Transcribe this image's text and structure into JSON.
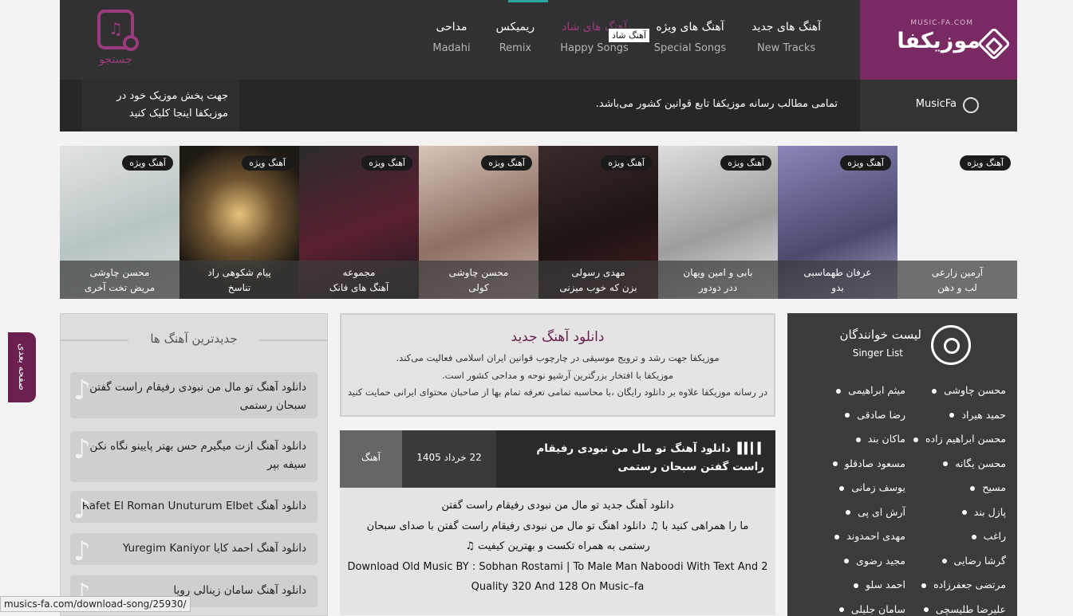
{
  "site": {
    "logo_text": "موزیکفا",
    "logo_site": "MUSIC-FA.COM"
  },
  "nav": [
    {
      "fa": "آهنگ های جدید",
      "en": "New Tracks"
    },
    {
      "fa": "آهنگ های ویژه",
      "en": "Special Songs"
    },
    {
      "fa": "آهنگ های شاد",
      "en": "Happy Songs"
    },
    {
      "fa": "ریمیکس",
      "en": "Remix"
    },
    {
      "fa": "مداحی",
      "en": "Madahi"
    }
  ],
  "tooltip": "آهنگ شاد",
  "search_label": "جستجو",
  "notice": {
    "brand": "MusicFa",
    "text": "تمامی مطالب رسانه موزیکفا تابع قوانین کشور می‌باشد.",
    "promo": "جهت پخش موزیک خود در موزیکفا اینجا کلیک کنید"
  },
  "slides": [
    {
      "badge": "آهنگ ویژه",
      "artist": "آرمین زارعی",
      "song": "لب و دهن",
      "bg": "linear-gradient(135deg,#b9bfc9,#7a808c 60,#d4d6dc)"
    },
    {
      "badge": "آهنگ ویژه",
      "artist": "عرفان طهماسبی",
      "song": "بدو",
      "bg": "linear-gradient(160deg,#8a86b8,#4b4a6e 60%,#a8a2c8)"
    },
    {
      "badge": "آهنگ ویژه",
      "artist": "بابی و امین ویهان",
      "song": "ددر دودور",
      "bg": "linear-gradient(160deg,#dedede,#9d9d9d 55%,#e9e9e9)"
    },
    {
      "badge": "آهنگ ویژه",
      "artist": "مهدی رسولی",
      "song": "بزن که خوب میزنی",
      "bg": "linear-gradient(160deg,#3a2b2b,#1e1414 55%,#4a1e1e)"
    },
    {
      "badge": "آهنگ ویژه",
      "artist": "محسن چاوشی",
      "song": "کولی",
      "bg": "linear-gradient(160deg,#d7c4b8,#8d6f63 55%,#c9b1a5)"
    },
    {
      "badge": "آهنگ ویژه",
      "artist": "مجموعه",
      "song": "آهنگ های فانک",
      "bg": "linear-gradient(160deg,#2b2b2b,#5a2030 55%,#1a1a1a)"
    },
    {
      "badge": "آهنگ ویژه",
      "artist": "پیام شکوهی راد",
      "song": "تناسخ",
      "bg": "radial-gradient(circle at 50% 45%,#e6c27a,#6e5330 35%,#1f1a14 70%)"
    },
    {
      "badge": "آهنگ ویژه",
      "artist": "محسن چاوشی",
      "song": "مریض تخت آخری",
      "bg": "linear-gradient(160deg,#e3e3e3,#b8c4c4 55%,#d8dbdb)"
    }
  ],
  "side_tab": "صفحه بعدی",
  "latest": {
    "title": "جدیدترین آهنگ ها",
    "items": [
      "دانلود آهنگ تو مال من نبودی رفیقام راست گفتن سبحان رستمی",
      "دانلود آهنگ ازت میگیرم حس بهتر پایینو نگاه نکن سیفه بپر",
      "دانلود آهنگ Rafet El Roman Unuturum Elbet",
      "دانلود آهنگ احمد کایا Yuregim Kaniyor",
      "دانلود آهنگ سامان زینالی رویا"
    ]
  },
  "intro": {
    "title": "دانلود آهنگ جدید",
    "lines": [
      "موزیکفا جهت رشد و ترویج موسیقی در چارچوب قوانین ایران اسلامی فعالیت می‌کند.",
      "موزیکفا با افتخار بزرگترین آرشیو نوحه و مداحی کشور است.",
      "در رسانه موزیکفا علاوه بر دانلود رایگان ،با محاسبه تمامی تعرفه تمام بها از صاحبان محتوای ایرانی حمایت کنید"
    ]
  },
  "post": {
    "title": "دانلود آهنگ تو مال من نبودی رفیقام راست گفتن سبحان رستمی",
    "date": "22 خرداد 1405",
    "category": "آهنگ"
  },
  "content": [
    "دانلود آهنگ جدید تو مال من نبودی رفیقام راست گفتن",
    "ما را همراهی کنید با ♫ دانلود اهنگ تو مال من نبودی رفیقام راست گفتن با صدای سبحان",
    "رستمی به همراه تکست و بهترین کیفیت ♫",
    "Download Old Music BY : Sobhan Rostami | To Male Man Naboodi With Text And 2",
    "Quality 320 And 128 On Music–fa"
  ],
  "singers": {
    "title": "لیست خوانندگان",
    "title_en": "Singer List",
    "col_right": [
      "محسن چاوشی",
      "حمید هیراد",
      "محسن ابراهیم زاده",
      "محسن یگانه",
      "مسیح",
      "پازل بند",
      "راغب",
      "گرشا رضایی",
      "مرتضی جعفرزاده",
      "علیرضا طلیسچی"
    ],
    "col_left": [
      "میثم ابراهیمی",
      "رضا صادقی",
      "ماکان بند",
      "مسعود صادقلو",
      "یوسف زمانی",
      "آرش ای پی",
      "مهدی احمدوند",
      "مجید رضوی",
      "احمد سلو",
      "سامان جلیلی"
    ]
  },
  "status_url": "musics-fa.com/download-song/25930/"
}
